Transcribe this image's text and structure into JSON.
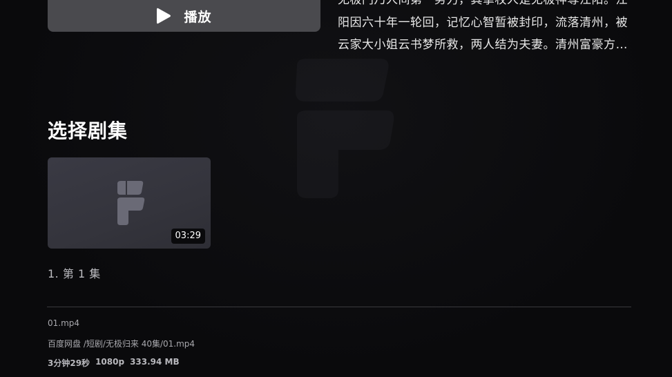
{
  "player": {
    "play_label": "播放"
  },
  "description": {
    "lines": [
      "无极门乃人间第一势力，其掌权人是无极神尊江阳。江",
      "阳因六十年一轮回，记忆心智暂被封印，流落清州，被",
      "云家大小姐云书梦所救，两人结为夫妻。清州富豪方…"
    ]
  },
  "episodes": {
    "section_title": "选择剧集",
    "items": [
      {
        "label": "1. 第 1 集",
        "duration": "03:29"
      }
    ]
  },
  "file_info": {
    "name": "01.mp4",
    "path": "百度网盘 /短剧/无极归来 40集/01.mp4",
    "duration": "3分钟29秒",
    "resolution": "1080p",
    "size": "333.94 MB"
  },
  "colors": {
    "background": "#0b0b0d",
    "play_button": "#4a4a4e",
    "card": "#3a3a44"
  }
}
